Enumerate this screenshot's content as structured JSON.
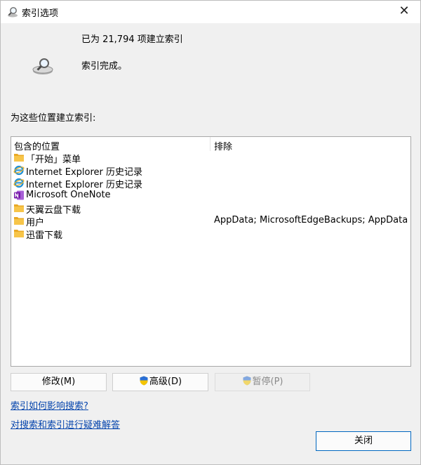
{
  "window": {
    "title": "索引选项",
    "close_glyph": "✕"
  },
  "status": {
    "indexed_count_text": "已为 21,794 项建立索引",
    "state_text": "索引完成。"
  },
  "locations": {
    "section_label": "为这些位置建立索引:",
    "columns": {
      "included": "包含的位置",
      "excluded": "排除"
    },
    "rows": [
      {
        "name": "「开始」菜单",
        "icon": "folder-icon",
        "excluded": ""
      },
      {
        "name": "Internet Explorer 历史记录",
        "icon": "internet-explorer-icon",
        "excluded": ""
      },
      {
        "name": "Internet Explorer 历史记录",
        "icon": "internet-explorer-icon",
        "excluded": ""
      },
      {
        "name": "Microsoft OneNote",
        "icon": "onenote-icon",
        "excluded": ""
      },
      {
        "name": "天翼云盘下载",
        "icon": "folder-icon",
        "excluded": ""
      },
      {
        "name": "用户",
        "icon": "folder-icon",
        "excluded": "AppData; MicrosoftEdgeBackups; AppData"
      },
      {
        "name": "迅雷下载",
        "icon": "folder-icon",
        "excluded": ""
      }
    ]
  },
  "buttons": {
    "modify": "修改(M)",
    "advanced": "高级(D)",
    "pause": "暂停(P)",
    "close": "关闭"
  },
  "links": {
    "how_indexing_affects_search": "索引如何影响搜索?",
    "troubleshoot": "对搜索和索引进行疑难解答"
  },
  "colors": {
    "folder": "#f7c549",
    "onenote": "#7719aa",
    "ie": "#1e90d6",
    "link": "#0645ad"
  }
}
